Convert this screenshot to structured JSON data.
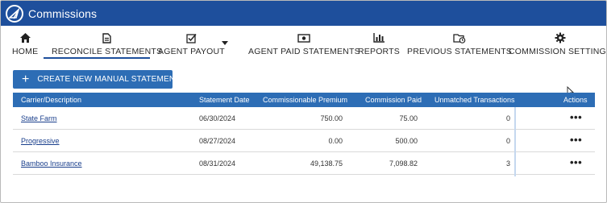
{
  "app": {
    "title": "Commissions",
    "brand_color": "#1e4f9c",
    "accent_color": "#2d6db5"
  },
  "nav": {
    "items": [
      {
        "label": "HOME",
        "icon": "home-icon"
      },
      {
        "label": "RECONCILE STATEMENTS",
        "icon": "document-icon",
        "active": true
      },
      {
        "label": "AGENT PAYOUT",
        "icon": "checkbox-icon",
        "has_dropdown": true
      },
      {
        "label": "AGENT PAID STATEMENTS",
        "icon": "money-icon"
      },
      {
        "label": "REPORTS",
        "icon": "bar-chart-icon"
      },
      {
        "label": "PREVIOUS STATEMENTS",
        "icon": "folder-clock-icon"
      },
      {
        "label": "COMMISSION SETTINGS",
        "icon": "gear-icon"
      }
    ]
  },
  "actions": {
    "create_label": "CREATE NEW MANUAL STATEMENT",
    "create_icon": "+"
  },
  "table": {
    "headers": {
      "carrier": "Carrier/Description",
      "date": "Statement Date",
      "premium": "Commissionable Premium",
      "paid": "Commission Paid",
      "unmatched": "Unmatched Transactions",
      "actions": "Actions"
    },
    "rows": [
      {
        "carrier": "State Farm",
        "date": "06/30/2024",
        "premium": "750.00",
        "paid": "75.00",
        "unmatched": "0",
        "actions": "•••"
      },
      {
        "carrier": "Progressive",
        "date": "08/27/2024",
        "premium": "0.00",
        "paid": "500.00",
        "unmatched": "0",
        "actions": "•••"
      },
      {
        "carrier": "Bamboo Insurance",
        "date": "08/31/2024",
        "premium": "49,138.75",
        "paid": "7,098.82",
        "unmatched": "3",
        "actions": "•••"
      }
    ]
  }
}
